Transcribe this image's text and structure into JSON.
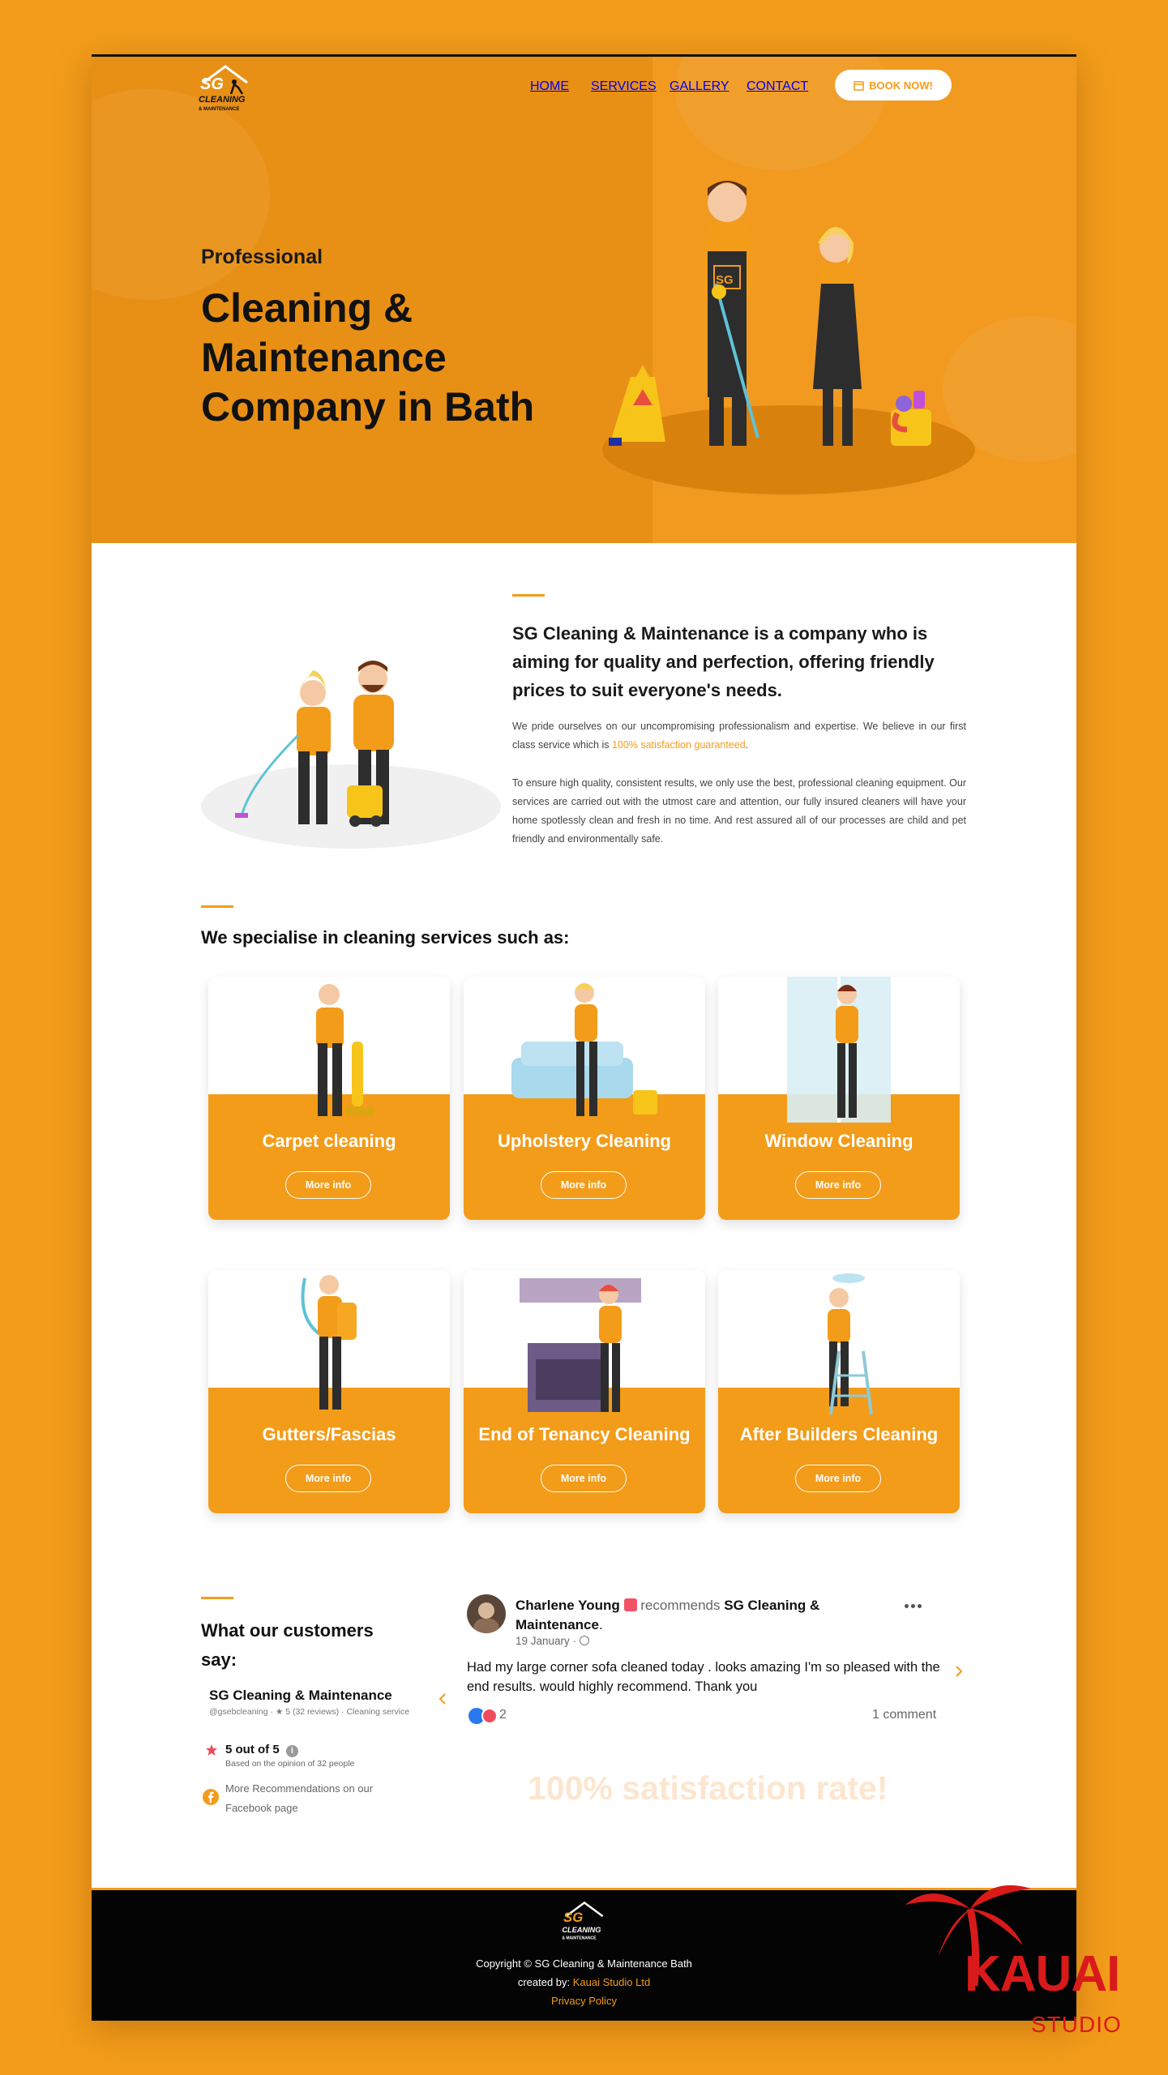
{
  "nav": {
    "logo_text": [
      "SG",
      "CLEANING",
      "& MAINTENANCE"
    ],
    "items": [
      "HOME",
      "SERVICES",
      "GALLERY",
      "CONTACT"
    ],
    "book_label": "BOOK NOW!"
  },
  "hero": {
    "pre_title": "Professional",
    "title": "Cleaning & Maintenance Company in Bath",
    "badge": "SG"
  },
  "about": {
    "heading": "SG Cleaning & Maintenance is a company who is aiming for quality and perfection, offering friendly prices to suit everyone's needs.",
    "p1_before": "We pride ourselves on our uncompromising professionalism and expertise. We believe in our first class service which is ",
    "p1_highlight": "100% satisfaction guaranteed",
    "p1_after": ".",
    "p2": "To ensure high quality, consistent results, we only use the best, professional cleaning equipment. Our services are carried out with the utmost care and attention, our fully insured cleaners will have your home spotlessly clean and fresh in no time. And rest assured all of our processes are child and pet friendly and environmentally safe."
  },
  "services": {
    "title": "We specialise in cleaning services such as:",
    "more_label": "More info",
    "items": [
      {
        "name": "Carpet cleaning",
        "icon": "carpet-cleaner-illustration"
      },
      {
        "name": "Upholstery Cleaning",
        "icon": "upholstery-cleaner-illustration"
      },
      {
        "name": "Window Cleaning",
        "icon": "window-cleaner-illustration"
      },
      {
        "name": "Gutters/Fascias",
        "icon": "gutter-cleaner-illustration"
      },
      {
        "name": "End of Tenancy Cleaning",
        "icon": "kitchen-cleaner-illustration"
      },
      {
        "name": "After Builders Cleaning",
        "icon": "builder-cleaner-illustration"
      }
    ]
  },
  "reviews": {
    "title": "What our customers say:",
    "page_name": "SG Cleaning & Maintenance",
    "page_meta": "@gsebcleaning · ★ 5 (32 reviews) · Cleaning service",
    "rating": "5 out of 5",
    "rating_sub": "Based on the opinion of 32 people",
    "fb_recommendations": "More Recommendations on our Facebook page",
    "post": {
      "author": "Charlene Young",
      "recommends": "recommends",
      "page": "SG Cleaning & Maintenance",
      "date": "19 January ·",
      "text": "Had my large corner sofa cleaned today . looks amazing I'm so pleased with the end results. would highly recommend.  Thank you",
      "reactions": "2",
      "comments": "1 comment"
    },
    "satisfaction": "100% satisfaction rate!"
  },
  "footer": {
    "copyright": "Copyright © SG Cleaning & Maintenance Bath",
    "created_by": "created by:",
    "studio": "Kauai Studio Ltd",
    "privacy": "Privacy Policy"
  },
  "watermark": {
    "name": "KAUAI",
    "sub": "STUDIO"
  },
  "colors": {
    "accent": "#f39c1a",
    "footer": "#040404",
    "watermark": "#d91a1a"
  }
}
